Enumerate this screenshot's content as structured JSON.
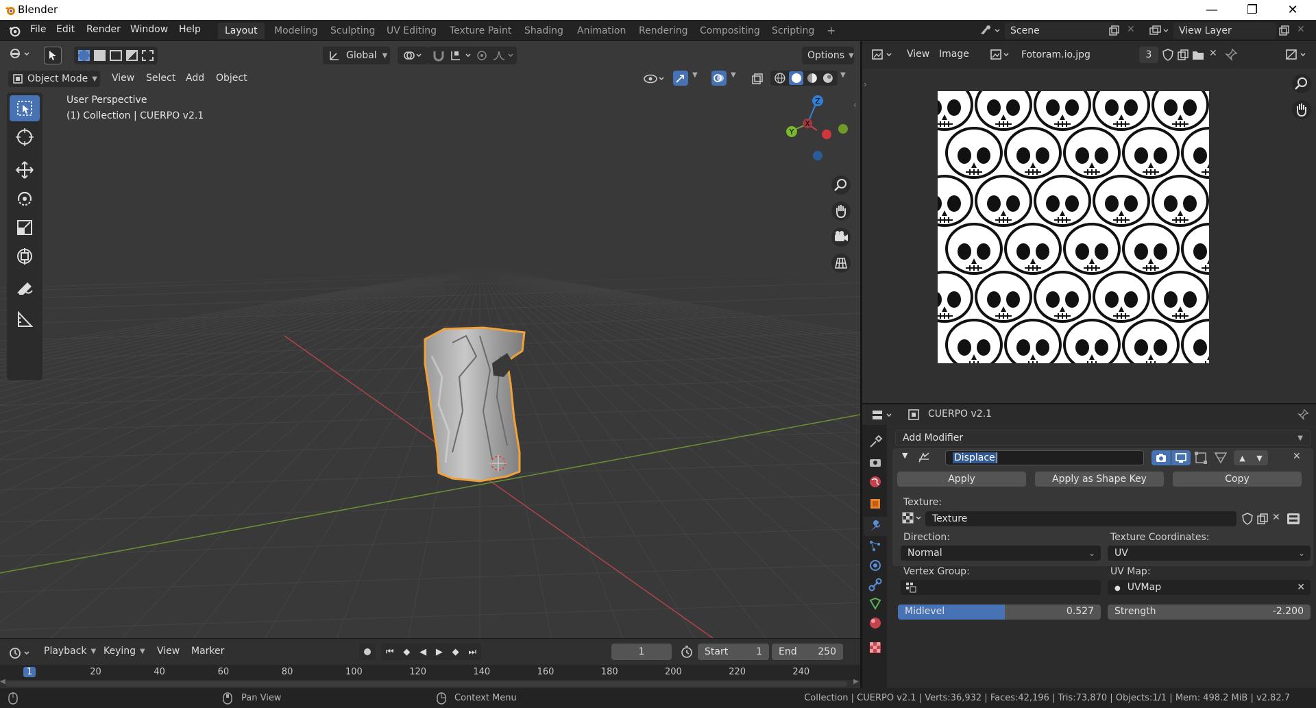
{
  "window": {
    "title": "Blender",
    "minimize_glyph": "—",
    "maximize_glyph": "❐",
    "close_glyph": "✕"
  },
  "menu": [
    "File",
    "Edit",
    "Render",
    "Window",
    "Help"
  ],
  "workspaces": [
    "Layout",
    "Modeling",
    "Sculpting",
    "UV Editing",
    "Texture Paint",
    "Shading",
    "Animation",
    "Rendering",
    "Compositing",
    "Scripting"
  ],
  "workspace_add": "+",
  "scene": {
    "name": "Scene",
    "view_layer": "View Layer"
  },
  "viewport": {
    "orientation": "Global",
    "options": "Options",
    "mode": "Object Mode",
    "menus": [
      "View",
      "Select",
      "Add",
      "Object"
    ],
    "overlay_title": "User Perspective",
    "overlay_collection": "(1) Collection | CUERPO v2.1",
    "gizmo": {
      "x": "X",
      "y": "Y",
      "z": "Z"
    }
  },
  "timeline": {
    "menus": [
      "Playback",
      "Keying",
      "View",
      "Marker"
    ],
    "current_frame": "1",
    "start_label": "Start",
    "start_value": "1",
    "end_label": "End",
    "end_value": "250",
    "ruler": [
      "1",
      "20",
      "40",
      "60",
      "80",
      "100",
      "120",
      "140",
      "160",
      "180",
      "200",
      "220",
      "240"
    ]
  },
  "image_editor": {
    "menus": [
      "View",
      "Image"
    ],
    "image_name": "Fotoram.io.jpg",
    "users": "3"
  },
  "properties": {
    "object_name": "CUERPO v2.1",
    "add_modifier": "Add Modifier",
    "modifier_name": "Displace",
    "apply": "Apply",
    "apply_shape_key": "Apply as Shape Key",
    "copy": "Copy",
    "texture_label": "Texture:",
    "texture_value": "Texture",
    "direction_label": "Direction:",
    "direction_value": "Normal",
    "texcoords_label": "Texture Coordinates:",
    "texcoords_value": "UV",
    "vgroup_label": "Vertex Group:",
    "uvmap_label": "UV Map:",
    "uvmap_value": "UVMap",
    "midlevel_label": "Midlevel",
    "midlevel_value": "0.527",
    "midlevel_fraction": 0.527,
    "strength_label": "Strength",
    "strength_value": "-2.200"
  },
  "statusbar": {
    "pan": "Pan View",
    "context": "Context Menu",
    "stats": "Collection | CUERPO v2.1 | Verts:36,932 | Faces:42,196 | Tris:73,870 | Objects:1/1 | Mem: 498.2 MiB | v2.82.7"
  },
  "colors": {
    "accent": "#4772b3",
    "selection_outline": "#f0a13a",
    "x_axis": "#c4434d",
    "y_axis": "#7ba535",
    "z_axis": "#3a82d2"
  }
}
